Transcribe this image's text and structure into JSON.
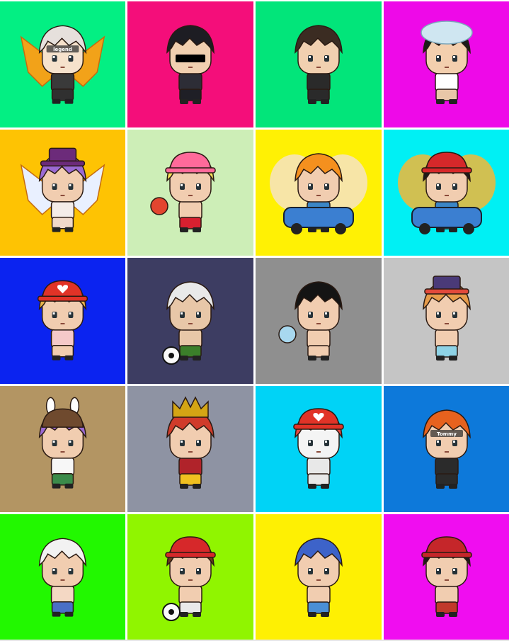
{
  "avatars": [
    {
      "bg": "#03ef83",
      "hair": "#e6e0dc",
      "face": "#f6e2cc",
      "shirt": "#3a3a3a",
      "pants": "#303030",
      "acc": "wings-fire",
      "accColor": "#f2a219",
      "tag": "legend"
    },
    {
      "bg": "#f40e7a",
      "hair": "#1d1d23",
      "face": "#f1d0b0",
      "shirt": "#2d2d36",
      "pants": "#1f1f26",
      "acc": "sunglasses",
      "accColor": "#000000",
      "tag": ""
    },
    {
      "bg": "#02e57a",
      "hair": "#3b2c22",
      "face": "#f1d0b0",
      "shirt": "#2a2a2a",
      "pants": "#2a2a2a",
      "acc": "none",
      "accColor": "#000000",
      "tag": ""
    },
    {
      "bg": "#ee09e8",
      "hair": "#1b1b1b",
      "face": "#f3cfae",
      "shirt": "#ffffff",
      "pants": "#e8c7a8",
      "acc": "cloud-hat",
      "accColor": "#cfe6f1",
      "tag": ""
    },
    {
      "bg": "#fec303",
      "hair": "#9b6ad3",
      "face": "#f1cdb0",
      "shirt": "#f4ece8",
      "pants": "#f1d9c9",
      "acc": "tophat-wings",
      "accColor": "#6c2b7a",
      "tag": ""
    },
    {
      "bg": "#cdeeb7",
      "hair": "#f7e15a",
      "face": "#f1cdb0",
      "shirt": "#f1cdb0",
      "pants": "#d82030",
      "acc": "cap-rainbow",
      "accColor": "#ff6a9a",
      "tag": ""
    },
    {
      "bg": "#fff104",
      "hair": "#f5901e",
      "face": "#f1cdb0",
      "shirt": "#3b86c6",
      "pants": "#3b86c6",
      "acc": "car-fairy",
      "accColor": "#f3d7a3",
      "tag": ""
    },
    {
      "bg": "#00f0f4",
      "hair": "#1b1b1b",
      "face": "#f1cdb0",
      "shirt": "#3b86c6",
      "pants": "#3b86c6",
      "acc": "car-cap",
      "accColor": "#d6282a",
      "tag": ""
    },
    {
      "bg": "#0b23f0",
      "hair": "#e8b34a",
      "face": "#f1cdb0",
      "shirt": "#f5c9c9",
      "pants": "#f1cdb0",
      "acc": "heart-cap",
      "accColor": "#e13327",
      "tag": ""
    },
    {
      "bg": "#3d3d62",
      "hair": "#e9e9e9",
      "face": "#e8c7a8",
      "shirt": "#e8c7a8",
      "pants": "#3b7f2a",
      "acc": "soccer",
      "accColor": "#111111",
      "tag": ""
    },
    {
      "bg": "#8f8f8f",
      "hair": "#141414",
      "face": "#f1cdb0",
      "shirt": "#f1cdb0",
      "pants": "#f1cdb0",
      "acc": "pinwheel",
      "accColor": "#8bc7e6",
      "tag": ""
    },
    {
      "bg": "#c5c5c5",
      "hair": "#e79c4b",
      "face": "#f1cdb0",
      "shirt": "#f1cdb0",
      "pants": "#8ed3e6",
      "acc": "purple-hat",
      "accColor": "#4a3a78",
      "tag": ""
    },
    {
      "bg": "#b39563",
      "hair": "#9b6ad3",
      "face": "#f1cdb0",
      "shirt": "#f7f7f7",
      "pants": "#3b8b4a",
      "acc": "bunny-hat",
      "accColor": "#6f4a2e",
      "tag": ""
    },
    {
      "bg": "#8e93a3",
      "hair": "#d03b2a",
      "face": "#f1cdb0",
      "shirt": "#b0232a",
      "pants": "#f0c020",
      "acc": "crown",
      "accColor": "#d4a514",
      "tag": ""
    },
    {
      "bg": "#00d3f6",
      "hair": "#e94c44",
      "face": "#f4f4f4",
      "shirt": "#e8e8e8",
      "pants": "#e8e8e8",
      "acc": "heart-cap",
      "accColor": "#e13327",
      "tag": ""
    },
    {
      "bg": "#0d79da",
      "hair": "#e7621e",
      "face": "#f1cdb0",
      "shirt": "#2b2b2b",
      "pants": "#2b2b2b",
      "acc": "none",
      "accColor": "#000000",
      "tag": "Tommy"
    },
    {
      "bg": "#22f800",
      "hair": "#f2f2f2",
      "face": "#f1cdb0",
      "shirt": "#f4d8c4",
      "pants": "#4a6fc6",
      "acc": "none",
      "accColor": "#000000",
      "tag": ""
    },
    {
      "bg": "#90f500",
      "hair": "#6b3a1e",
      "face": "#f1cdb0",
      "shirt": "#f1cdb0",
      "pants": "#e9e9e9",
      "acc": "cap-soccer",
      "accColor": "#d6282a",
      "tag": ""
    },
    {
      "bg": "#fef003",
      "hair": "#3d63c9",
      "face": "#f1cdb0",
      "shirt": "#f1cdb0",
      "pants": "#4a8fd6",
      "acc": "none",
      "accColor": "#000000",
      "tag": ""
    },
    {
      "bg": "#f00df0",
      "hair": "#1b1b1b",
      "face": "#f1cdb0",
      "shirt": "#f1cdb0",
      "pants": "#c1392b",
      "acc": "bear-cap",
      "accColor": "#c5262a",
      "tag": ""
    }
  ]
}
